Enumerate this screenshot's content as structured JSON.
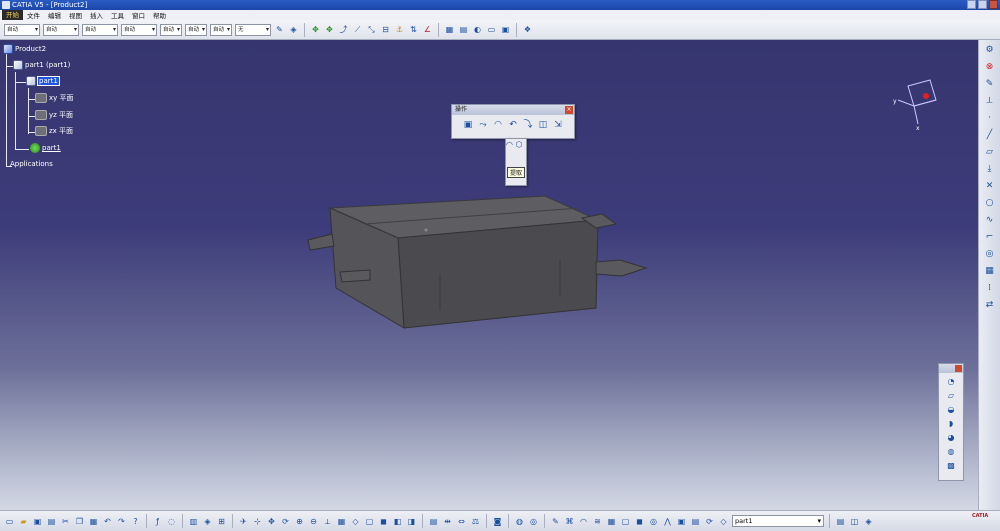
{
  "window": {
    "title": "CATIA V5 - [Product2]"
  },
  "menu": {
    "start": "开始",
    "items": [
      "文件",
      "编辑",
      "视图",
      "插入",
      "工具",
      "窗口",
      "帮助"
    ]
  },
  "top_toolbar": {
    "combos": [
      "自动",
      "自动",
      "自动",
      "自动",
      "自动",
      "自动",
      "自动",
      "无"
    ]
  },
  "tree": {
    "root": "Product2",
    "part_instance": "part1 (part1)",
    "part": "part1",
    "planes": [
      "xy 平面",
      "yz 平面",
      "zx 平面"
    ],
    "body": "part1",
    "applications": "Applications"
  },
  "op_toolbar": {
    "title": "操作"
  },
  "tooltip": {
    "text": "提取"
  },
  "bottom_toolbar": {
    "part_selector": "part1"
  },
  "brand": {
    "logo": "CATIA"
  },
  "colors": {
    "selection": "#2255dd",
    "viewport_top": "#36356f",
    "viewport_bottom": "#d4d8e4"
  }
}
